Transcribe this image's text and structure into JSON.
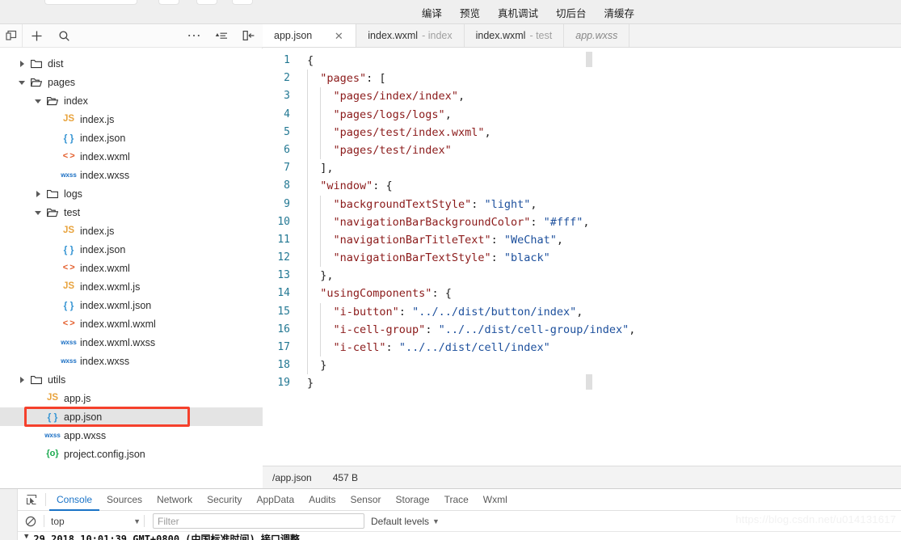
{
  "top_bar": {
    "actions": [
      {
        "label": "编译",
        "name": "compile-button"
      },
      {
        "label": "预览",
        "name": "preview-button"
      },
      {
        "label": "真机调试",
        "name": "remote-debug-button"
      },
      {
        "label": "切后台",
        "name": "background-button"
      },
      {
        "label": "清缓存",
        "name": "clear-cache-button"
      }
    ]
  },
  "sidebar": {
    "toolbar": {
      "panel_icon": "panel-icon",
      "add_icon": "plus-icon",
      "search_icon": "search-icon",
      "more_icon": "ellipsis-icon",
      "sort_icon": "sort-icon",
      "collapse_icon": "collapse-panel-icon"
    },
    "tree": [
      {
        "label": "dist",
        "icon": "folder-closed",
        "indent": 0,
        "twisty": "right",
        "selected": false
      },
      {
        "label": "pages",
        "icon": "folder-open",
        "indent": 0,
        "twisty": "down",
        "selected": false
      },
      {
        "label": "index",
        "icon": "folder-open",
        "indent": 1,
        "twisty": "down",
        "selected": false
      },
      {
        "label": "index.js",
        "icon": "js",
        "indent": 2,
        "twisty": "none",
        "selected": false
      },
      {
        "label": "index.json",
        "icon": "json",
        "indent": 2,
        "twisty": "none",
        "selected": false
      },
      {
        "label": "index.wxml",
        "icon": "wxml",
        "indent": 2,
        "twisty": "none",
        "selected": false
      },
      {
        "label": "index.wxss",
        "icon": "wxss",
        "indent": 2,
        "twisty": "none",
        "selected": false
      },
      {
        "label": "logs",
        "icon": "folder-closed",
        "indent": 1,
        "twisty": "right",
        "selected": false
      },
      {
        "label": "test",
        "icon": "folder-open",
        "indent": 1,
        "twisty": "down",
        "selected": false
      },
      {
        "label": "index.js",
        "icon": "js",
        "indent": 2,
        "twisty": "none",
        "selected": false
      },
      {
        "label": "index.json",
        "icon": "json",
        "indent": 2,
        "twisty": "none",
        "selected": false
      },
      {
        "label": "index.wxml",
        "icon": "wxml",
        "indent": 2,
        "twisty": "none",
        "selected": false
      },
      {
        "label": "index.wxml.js",
        "icon": "js",
        "indent": 2,
        "twisty": "none",
        "selected": false
      },
      {
        "label": "index.wxml.json",
        "icon": "json",
        "indent": 2,
        "twisty": "none",
        "selected": false
      },
      {
        "label": "index.wxml.wxml",
        "icon": "wxml",
        "indent": 2,
        "twisty": "none",
        "selected": false
      },
      {
        "label": "index.wxml.wxss",
        "icon": "wxss",
        "indent": 2,
        "twisty": "none",
        "selected": false
      },
      {
        "label": "index.wxss",
        "icon": "wxss",
        "indent": 2,
        "twisty": "none",
        "selected": false
      },
      {
        "label": "utils",
        "icon": "folder-closed",
        "indent": 0,
        "twisty": "right",
        "selected": false
      },
      {
        "label": "app.js",
        "icon": "js",
        "indent": 1,
        "twisty": "none",
        "selected": false
      },
      {
        "label": "app.json",
        "icon": "json",
        "indent": 1,
        "twisty": "none",
        "selected": true
      },
      {
        "label": "app.wxss",
        "icon": "wxss",
        "indent": 1,
        "twisty": "none",
        "selected": false
      },
      {
        "label": "project.config.json",
        "icon": "cfg",
        "indent": 1,
        "twisty": "none",
        "selected": false
      }
    ],
    "highlight_color": "#f5402c"
  },
  "editor": {
    "tabs": [
      {
        "name": "app.json",
        "sub": "",
        "active": true,
        "preview": false,
        "closable": true
      },
      {
        "name": "index.wxml",
        "sub": "- index",
        "active": false,
        "preview": false,
        "closable": false
      },
      {
        "name": "index.wxml",
        "sub": "- test",
        "active": false,
        "preview": false,
        "closable": false
      },
      {
        "name": "app.wxss",
        "sub": "",
        "active": false,
        "preview": true,
        "closable": false
      }
    ],
    "close_glyph": "✕",
    "language": "json",
    "lines": [
      {
        "n": 1,
        "tokens": [
          {
            "t": "pun",
            "v": "{"
          }
        ]
      },
      {
        "n": 2,
        "tokens": [
          {
            "t": "pun",
            "v": "  "
          },
          {
            "t": "key",
            "v": "\"pages\""
          },
          {
            "t": "pun",
            "v": ": ["
          }
        ]
      },
      {
        "n": 3,
        "tokens": [
          {
            "t": "pun",
            "v": "    "
          },
          {
            "t": "key",
            "v": "\"pages/index/index\""
          },
          {
            "t": "pun",
            "v": ","
          }
        ]
      },
      {
        "n": 4,
        "tokens": [
          {
            "t": "pun",
            "v": "    "
          },
          {
            "t": "key",
            "v": "\"pages/logs/logs\""
          },
          {
            "t": "pun",
            "v": ","
          }
        ]
      },
      {
        "n": 5,
        "tokens": [
          {
            "t": "pun",
            "v": "    "
          },
          {
            "t": "key",
            "v": "\"pages/test/index.wxml\""
          },
          {
            "t": "pun",
            "v": ","
          }
        ]
      },
      {
        "n": 6,
        "tokens": [
          {
            "t": "pun",
            "v": "    "
          },
          {
            "t": "key",
            "v": "\"pages/test/index\""
          }
        ]
      },
      {
        "n": 7,
        "tokens": [
          {
            "t": "pun",
            "v": "  ],"
          }
        ]
      },
      {
        "n": 8,
        "tokens": [
          {
            "t": "pun",
            "v": "  "
          },
          {
            "t": "key",
            "v": "\"window\""
          },
          {
            "t": "pun",
            "v": ": {"
          }
        ]
      },
      {
        "n": 9,
        "tokens": [
          {
            "t": "pun",
            "v": "    "
          },
          {
            "t": "key",
            "v": "\"backgroundTextStyle\""
          },
          {
            "t": "pun",
            "v": ": "
          },
          {
            "t": "str",
            "v": "\"light\""
          },
          {
            "t": "pun",
            "v": ","
          }
        ]
      },
      {
        "n": 10,
        "tokens": [
          {
            "t": "pun",
            "v": "    "
          },
          {
            "t": "key",
            "v": "\"navigationBarBackgroundColor\""
          },
          {
            "t": "pun",
            "v": ": "
          },
          {
            "t": "str",
            "v": "\"#fff\""
          },
          {
            "t": "pun",
            "v": ","
          }
        ]
      },
      {
        "n": 11,
        "tokens": [
          {
            "t": "pun",
            "v": "    "
          },
          {
            "t": "key",
            "v": "\"navigationBarTitleText\""
          },
          {
            "t": "pun",
            "v": ": "
          },
          {
            "t": "str",
            "v": "\"WeChat\""
          },
          {
            "t": "pun",
            "v": ","
          }
        ]
      },
      {
        "n": 12,
        "tokens": [
          {
            "t": "pun",
            "v": "    "
          },
          {
            "t": "key",
            "v": "\"navigationBarTextStyle\""
          },
          {
            "t": "pun",
            "v": ": "
          },
          {
            "t": "str",
            "v": "\"black\""
          }
        ]
      },
      {
        "n": 13,
        "tokens": [
          {
            "t": "pun",
            "v": "  },"
          }
        ]
      },
      {
        "n": 14,
        "tokens": [
          {
            "t": "pun",
            "v": "  "
          },
          {
            "t": "key",
            "v": "\"usingComponents\""
          },
          {
            "t": "pun",
            "v": ": {"
          }
        ]
      },
      {
        "n": 15,
        "tokens": [
          {
            "t": "pun",
            "v": "    "
          },
          {
            "t": "key",
            "v": "\"i-button\""
          },
          {
            "t": "pun",
            "v": ": "
          },
          {
            "t": "str",
            "v": "\"../../dist/button/index\""
          },
          {
            "t": "pun",
            "v": ","
          }
        ]
      },
      {
        "n": 16,
        "tokens": [
          {
            "t": "pun",
            "v": "    "
          },
          {
            "t": "key",
            "v": "\"i-cell-group\""
          },
          {
            "t": "pun",
            "v": ": "
          },
          {
            "t": "str",
            "v": "\"../../dist/cell-group/index\""
          },
          {
            "t": "pun",
            "v": ","
          }
        ]
      },
      {
        "n": 17,
        "tokens": [
          {
            "t": "pun",
            "v": "    "
          },
          {
            "t": "key",
            "v": "\"i-cell\""
          },
          {
            "t": "pun",
            "v": ": "
          },
          {
            "t": "str",
            "v": "\"../../dist/cell/index\""
          }
        ]
      },
      {
        "n": 18,
        "tokens": [
          {
            "t": "pun",
            "v": "  }"
          }
        ]
      },
      {
        "n": 19,
        "tokens": [
          {
            "t": "pun",
            "v": "}"
          }
        ]
      }
    ],
    "status": {
      "path": "/app.json",
      "size": "457 B"
    }
  },
  "devtools": {
    "inspect_icon": "inspect-element-icon",
    "tabs": [
      {
        "label": "Console",
        "active": true
      },
      {
        "label": "Sources",
        "active": false
      },
      {
        "label": "Network",
        "active": false
      },
      {
        "label": "Security",
        "active": false
      },
      {
        "label": "AppData",
        "active": false
      },
      {
        "label": "Audits",
        "active": false
      },
      {
        "label": "Sensor",
        "active": false
      },
      {
        "label": "Storage",
        "active": false
      },
      {
        "label": "Trace",
        "active": false
      },
      {
        "label": "Wxml",
        "active": false
      }
    ],
    "clear_icon": "clear-console-icon",
    "context_value": "top",
    "filter_placeholder": "Filter",
    "filter_value": "",
    "levels_label": "Default levels",
    "log_entry": "29 2018 10:01:39 GMT+0800 (中国标准时间) 接口调整"
  },
  "watermark": "https://blog.csdn.net/u014131617",
  "colors": {
    "accent": "#1a73c7",
    "highlight": "#f5402c",
    "json_key": "#8b1a1a",
    "json_string": "#1c4f9c",
    "line_number": "#237893"
  }
}
